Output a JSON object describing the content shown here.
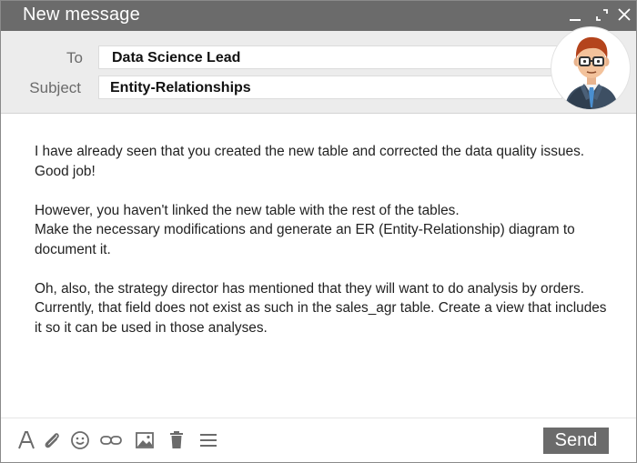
{
  "window": {
    "title": "New message"
  },
  "header": {
    "to_label": "To",
    "to_value": "Data Science Lead",
    "subject_label": "Subject",
    "subject_value": "Entity-Relationships"
  },
  "body": {
    "paragraphs": [
      "I have already seen that you created the new table and corrected the data quality issues. Good job!",
      "However, you haven't linked the new table with the rest of the tables.\nMake the necessary modifications and generate an ER (Entity-Relationship) diagram to document it.",
      "Oh, also, the strategy director has mentioned that they will want to do analysis by orders. Currently, that field does not exist as such in the sales_agr table. Create a view that includes it so it can be used in those analyses."
    ]
  },
  "toolbar": {
    "icons": [
      "text-format-icon",
      "paperclip-icon",
      "emoji-icon",
      "link-icon",
      "image-icon",
      "trash-icon",
      "more-options-icon"
    ],
    "send_label": "Send"
  },
  "colors": {
    "titlebar": "#6b6b6b",
    "header_bg": "#ececec",
    "send_button": "#6b6b6b",
    "icon": "#6b6b6b"
  }
}
